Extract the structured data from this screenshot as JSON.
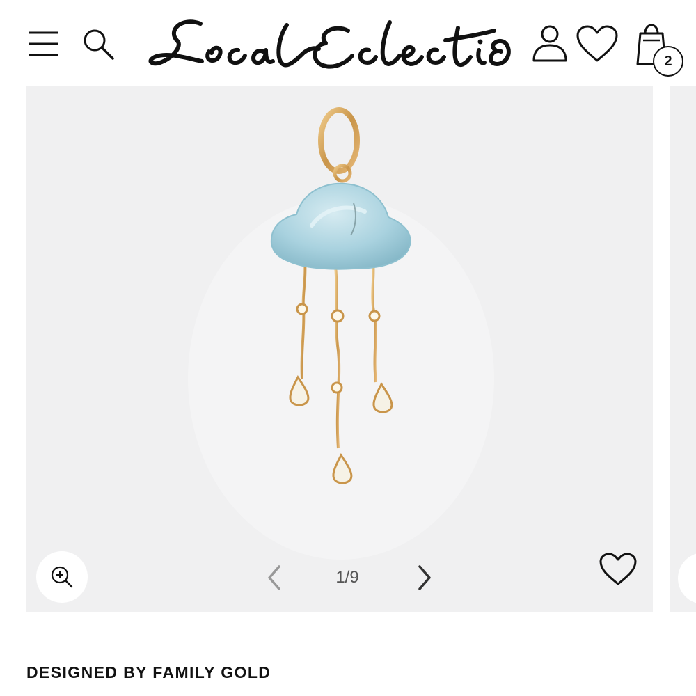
{
  "header": {
    "brand": "Local Eclectic",
    "bag_count": "2",
    "icons": [
      "menu-icon",
      "search-icon",
      "account-icon",
      "heart-icon",
      "shopping-bag-icon"
    ]
  },
  "gallery": {
    "pager": "1/9",
    "icons": [
      "zoom-in-icon",
      "chevron-left-icon",
      "chevron-right-icon",
      "heart-icon"
    ]
  },
  "product": {
    "designer_line": "DESIGNED BY FAMILY GOLD"
  },
  "colors": {
    "text": "#111111",
    "gallery_bg": "#f0f0f1",
    "stone": "#a9d2df",
    "gold": "#d0a257"
  }
}
